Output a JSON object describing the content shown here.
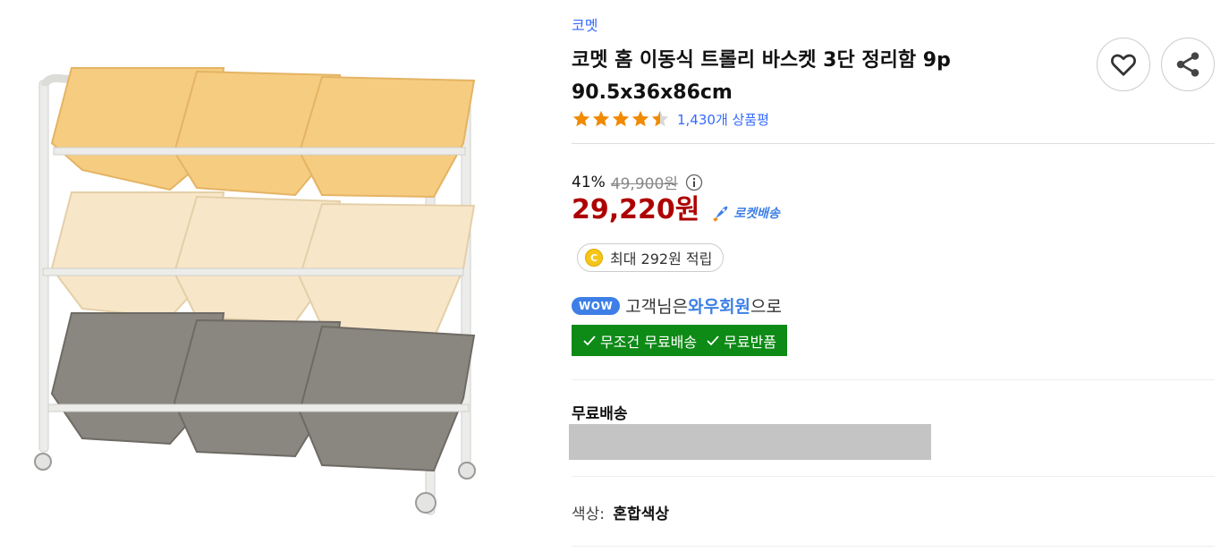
{
  "product": {
    "brand": "코멧",
    "title": "코멧 홈 이동식 트롤리 바스켓 3단 정리함 9p 90.5x36x86cm",
    "rating": 4.5,
    "review_count_label": "1,430개 상품평"
  },
  "price": {
    "discount_rate": "41%",
    "original_price": "49,900원",
    "sale_price": "29,220원",
    "delivery_badge": "로켓배송"
  },
  "points": {
    "coin_letter": "C",
    "label": "최대 292원 적립"
  },
  "wow": {
    "badge": "WOW",
    "text_before": "고객님은 ",
    "text_strong": "와우회원",
    "text_after": "으로",
    "benefit_1": "무조건 무료배송",
    "benefit_2": "무료반품"
  },
  "shipping": {
    "title": "무료배송"
  },
  "option": {
    "label": "색상:",
    "value": "혼합색상"
  },
  "colors": {
    "accent": "#346aff",
    "price": "#ae0000",
    "wow": "#3d7fe6",
    "benefit_bg": "#0e8a16",
    "star": "#f08a00"
  },
  "icons": {
    "wishlist": "heart-icon",
    "share": "share-icon",
    "info": "info-icon",
    "rocket": "rocket-icon",
    "check": "check-icon"
  }
}
